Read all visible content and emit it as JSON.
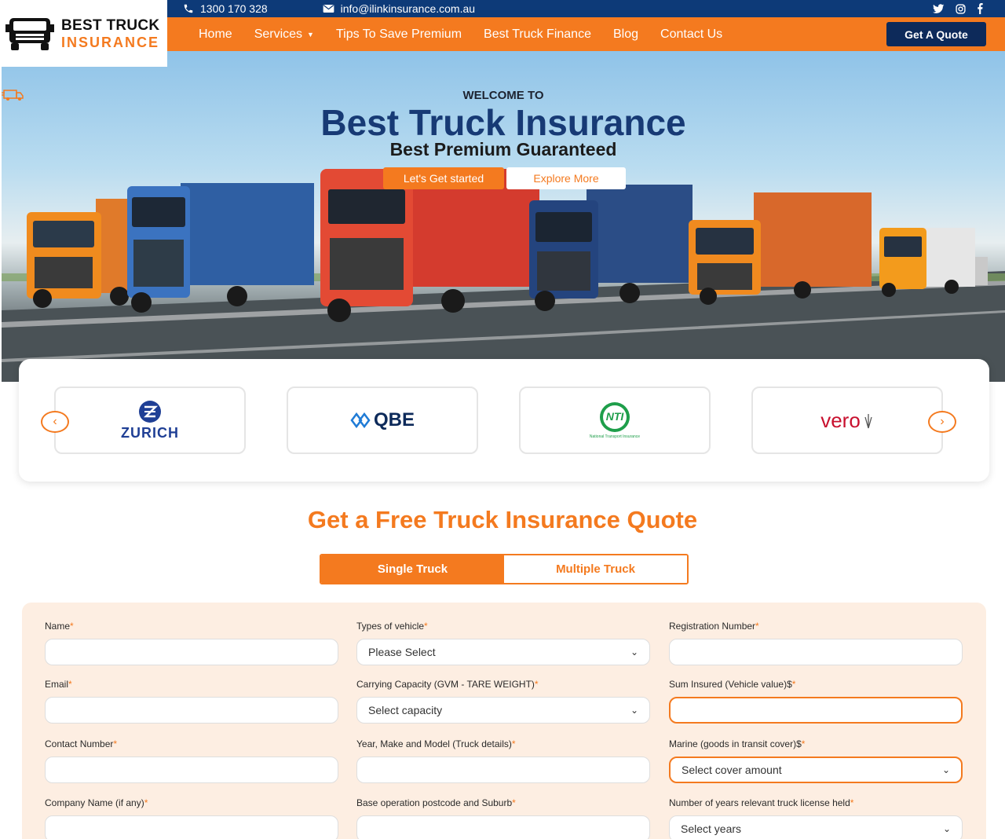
{
  "header": {
    "phone": "1300 170 328",
    "email": "info@ilinkinsurance.com.au",
    "logo_line1": "BEST TRUCK",
    "logo_line2": "INSURANCE",
    "nav": [
      "Home",
      "Services",
      "Tips To Save Premium",
      "Best Truck Finance",
      "Blog",
      "Contact Us"
    ],
    "quote_button": "Get A Quote",
    "social_icons": [
      "twitter-icon",
      "instagram-icon",
      "facebook-icon"
    ]
  },
  "hero": {
    "welcome": "WELCOME TO",
    "title": "Best Truck Insurance",
    "subtitle": "Best Premium Guaranteed",
    "btn_start": "Let's Get started",
    "btn_explore": "Explore More"
  },
  "partners": {
    "logos": [
      {
        "name": "ZURICH"
      },
      {
        "name": "QBE"
      },
      {
        "name": "NTI",
        "sub": "National Transport Insurance"
      },
      {
        "name": "vero"
      }
    ]
  },
  "quote": {
    "title": "Get a Free Truck Insurance Quote",
    "tabs": [
      "Single Truck",
      "Multiple Truck"
    ],
    "fields": {
      "name": "Name",
      "vehicle_type": "Types of vehicle",
      "vehicle_type_value": "Please Select",
      "registration": "Registration Number",
      "email": "Email",
      "capacity": "Carrying Capacity (GVM - TARE WEIGHT)",
      "capacity_value": "Select capacity",
      "sum_insured": "Sum Insured (Vehicle value)$",
      "contact": "Contact Number",
      "truck_details": "Year, Make and Model (Truck details)",
      "marine": "Marine (goods in transit cover)$",
      "marine_value": "Select cover amount",
      "company": "Company Name (if any)",
      "postcode": "Base operation postcode and Suburb",
      "license_years": "Number of years relevant truck license held",
      "license_years_value": "Select years"
    }
  },
  "colors": {
    "accent": "#f47a1f",
    "navy": "#0d3a78",
    "dark_navy": "#0d2a5a"
  }
}
